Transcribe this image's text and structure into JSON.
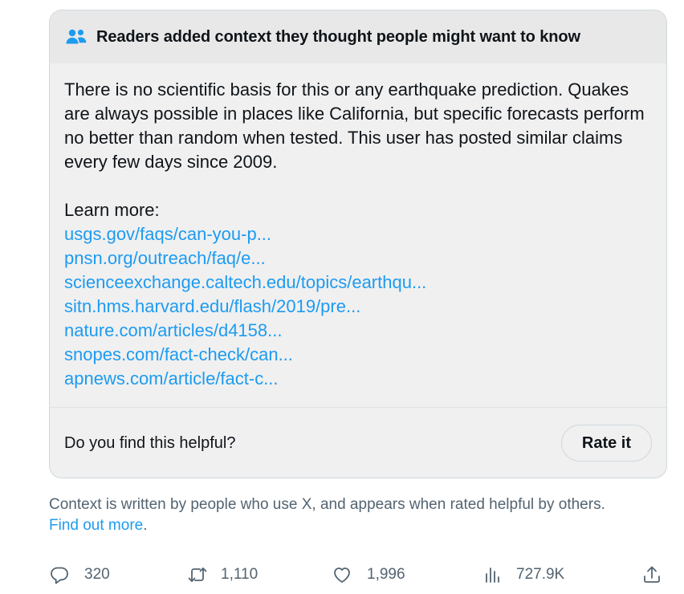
{
  "note": {
    "header_title": "Readers added context they thought people might want to know",
    "header_icon": "people-icon",
    "body_text": "There is no scientific basis for this or any earthquake prediction. Quakes are always possible in places like California, but specific forecasts perform no better than random when tested. This user has posted similar claims every few days since 2009.",
    "learn_more_label": "Learn more:",
    "links": [
      "usgs.gov/faqs/can-you-p...",
      "pnsn.org/outreach/faq/e...",
      "scienceexchange.caltech.edu/topics/earthqu...",
      "sitn.hms.harvard.edu/flash/2019/pre...",
      "nature.com/articles/d4158...",
      "snopes.com/fact-check/can...",
      "apnews.com/article/fact-c..."
    ],
    "helpful_question": "Do you find this helpful?",
    "rate_button": "Rate it"
  },
  "context_note": {
    "text": "Context is written by people who use X, and appears when rated helpful by others.",
    "link": "Find out more",
    "suffix": "."
  },
  "actions": {
    "replies": "320",
    "reposts": "1,110",
    "likes": "1,996",
    "views": "727.9K"
  },
  "colors": {
    "accent": "#1d9bf0",
    "text": "#0f1419",
    "muted": "#536471",
    "card_bg": "#f0f0f0",
    "header_bg": "#e8e8e8"
  }
}
